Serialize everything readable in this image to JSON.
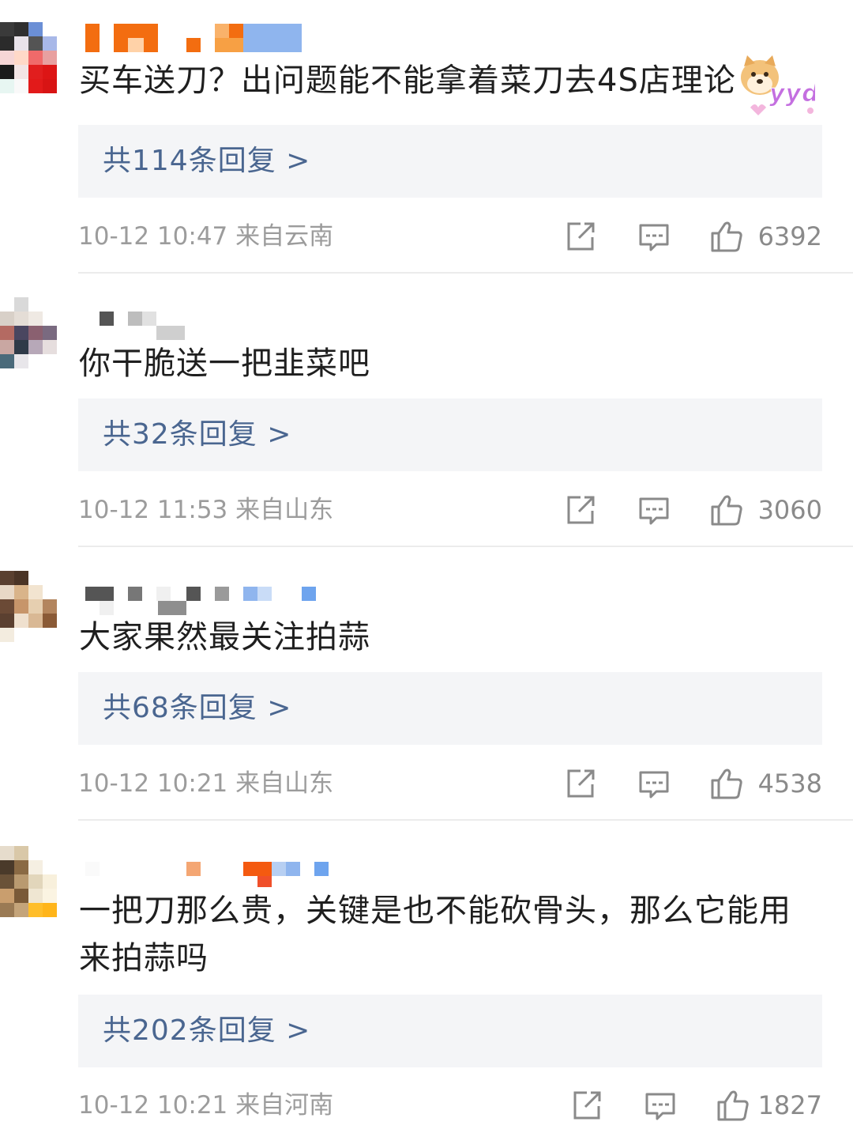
{
  "comments": [
    {
      "text": "买车送刀？出问题能不能拿着菜刀去4S店理论",
      "sticker": "doge-yyds-sticker",
      "replies_label": "共114条回复 >",
      "time_location": "10-12 10:47  来自云南",
      "likes": "6392"
    },
    {
      "text": "你干脆送一把韭菜吧",
      "replies_label": "共32条回复 >",
      "time_location": "10-12 11:53  来自山东",
      "likes": "3060"
    },
    {
      "text": "大家果然最关注拍蒜",
      "replies_label": "共68条回复 >",
      "time_location": "10-12 10:21  来自山东",
      "likes": "4538"
    },
    {
      "text": "一把刀那么贵，关键是也不能砍骨头，那么它能用来拍蒜吗",
      "replies_label": "共202条回复 >",
      "time_location": "10-12 10:21  来自河南",
      "likes": "1827"
    }
  ],
  "sticker_text": "yyds",
  "icons": {
    "share": "share-icon",
    "reply": "comment-icon",
    "like": "thumbs-up-icon"
  },
  "colors": {
    "reply_link": "#4a6690",
    "reply_box_bg": "#f4f5f7",
    "meta_text": "#9c9c9c",
    "icon_stroke": "#8a8a8a"
  }
}
